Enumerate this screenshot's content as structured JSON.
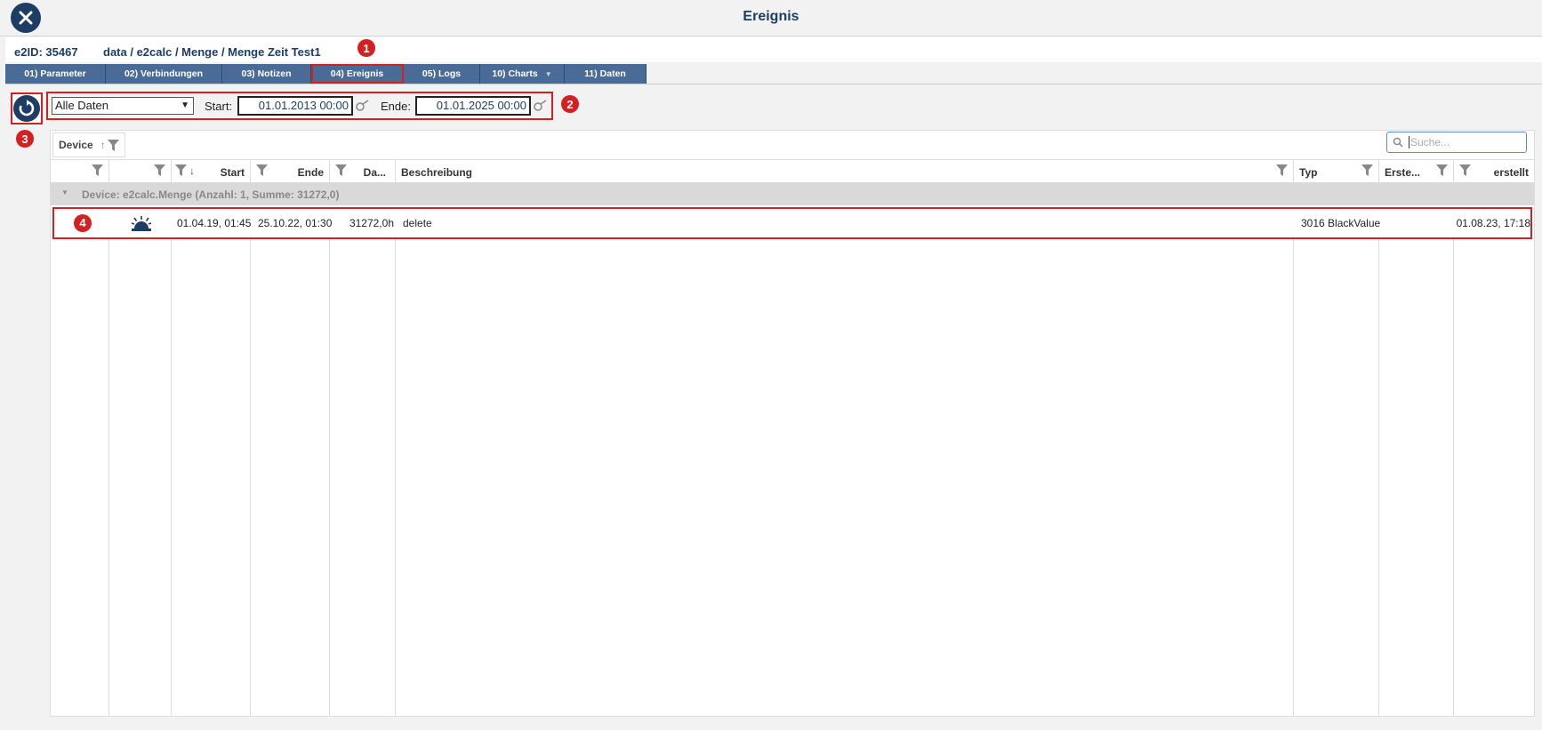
{
  "window": {
    "title": "Ereignis"
  },
  "info": {
    "id_label": "e2ID: 35467",
    "path": "data / e2calc / Menge / Menge Zeit Test1"
  },
  "tabs": [
    {
      "label": "01) Parameter"
    },
    {
      "label": "02) Verbindungen"
    },
    {
      "label": "03) Notizen"
    },
    {
      "label": "04) Ereignis"
    },
    {
      "label": "05) Logs"
    },
    {
      "label": "10) Charts"
    },
    {
      "label": "11) Daten"
    }
  ],
  "annotations": [
    "1",
    "2",
    "3",
    "4"
  ],
  "filter": {
    "range_value": "Alle Daten",
    "start_label": "Start:",
    "start_value": "01.01.2013 00:00",
    "end_label": "Ende:",
    "end_value": "01.01.2025 00:00"
  },
  "grid": {
    "group_chip": "Device",
    "search_placeholder": "Suche...",
    "columns": [
      "",
      "",
      "Start",
      "Ende",
      "Da...",
      "Beschreibung",
      "Typ",
      "Erste...",
      "erstellt"
    ],
    "group_row": "Device: e2calc.Menge (Anzahl: 1, Summe: 31272,0)",
    "row": {
      "start": "01.04.19, 01:45",
      "ende": "25.10.22, 01:30",
      "dauer": "31272,0h",
      "beschreibung": "delete",
      "typ": "3016 BlackValue",
      "erste": "",
      "erstellt": "01.08.23, 17:18"
    }
  },
  "colors": {
    "accent": "#1d3d66",
    "tab": "#4a6b95",
    "highlight": "#d42020"
  }
}
